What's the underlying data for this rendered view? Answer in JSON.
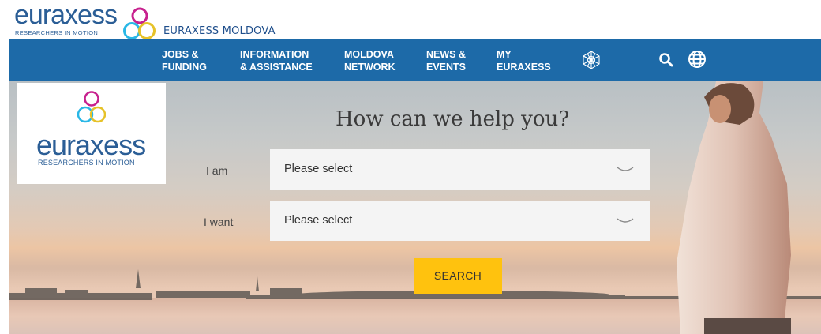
{
  "brand": {
    "wordmark": "euraxess",
    "tagline": "RESEARCHERS IN MOTION",
    "site_name": "EURAXESS MOLDOVA"
  },
  "nav": {
    "items": [
      {
        "line1": "JOBS &",
        "line2": "FUNDING"
      },
      {
        "line1": "INFORMATION",
        "line2": "& ASSISTANCE"
      },
      {
        "line1": "MOLDOVA",
        "line2": "NETWORK"
      },
      {
        "line1": "NEWS &",
        "line2": "EVENTS"
      },
      {
        "line1": "MY",
        "line2": "EURAXESS"
      }
    ],
    "icons": [
      "network-icon",
      "search-icon",
      "globe-icon"
    ]
  },
  "hero": {
    "title": "How can we help you?",
    "i_am": {
      "label": "I am",
      "value": "Please select"
    },
    "i_want": {
      "label": "I want",
      "value": "Please select"
    },
    "search_label": "SEARCH"
  },
  "colors": {
    "nav_bg": "#1d6aa8",
    "brand_blue": "#2b5e96",
    "search_button": "#ffc20e",
    "ring_cyan": "#29b7e6",
    "ring_magenta": "#c7218e",
    "ring_yellow": "#e6c229"
  }
}
